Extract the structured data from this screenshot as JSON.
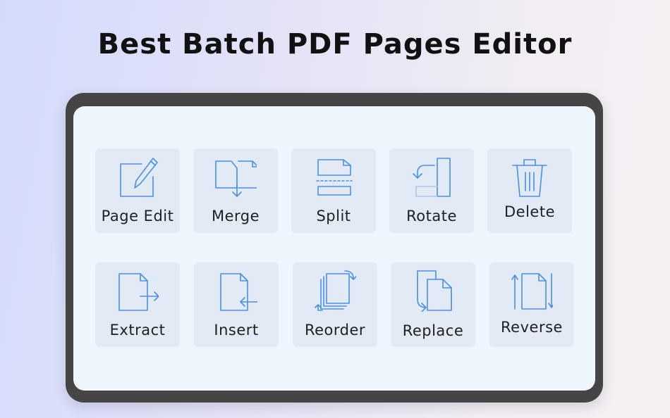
{
  "headline": "Best Batch PDF Pages Editor",
  "colors": {
    "accent": "#4a90e2",
    "tile": "#e2eaf5",
    "screen": "#eff5fd",
    "bezel": "#454545"
  },
  "tools": [
    {
      "label": "Page Edit",
      "icon": "page-edit-icon"
    },
    {
      "label": "Merge",
      "icon": "merge-icon"
    },
    {
      "label": "Split",
      "icon": "split-icon"
    },
    {
      "label": "Rotate",
      "icon": "rotate-icon"
    },
    {
      "label": "Delete",
      "icon": "trash-icon"
    },
    {
      "label": "Extract",
      "icon": "extract-icon"
    },
    {
      "label": "Insert",
      "icon": "insert-icon"
    },
    {
      "label": "Reorder",
      "icon": "reorder-icon"
    },
    {
      "label": "Replace",
      "icon": "replace-icon"
    },
    {
      "label": "Reverse",
      "icon": "reverse-icon"
    }
  ]
}
